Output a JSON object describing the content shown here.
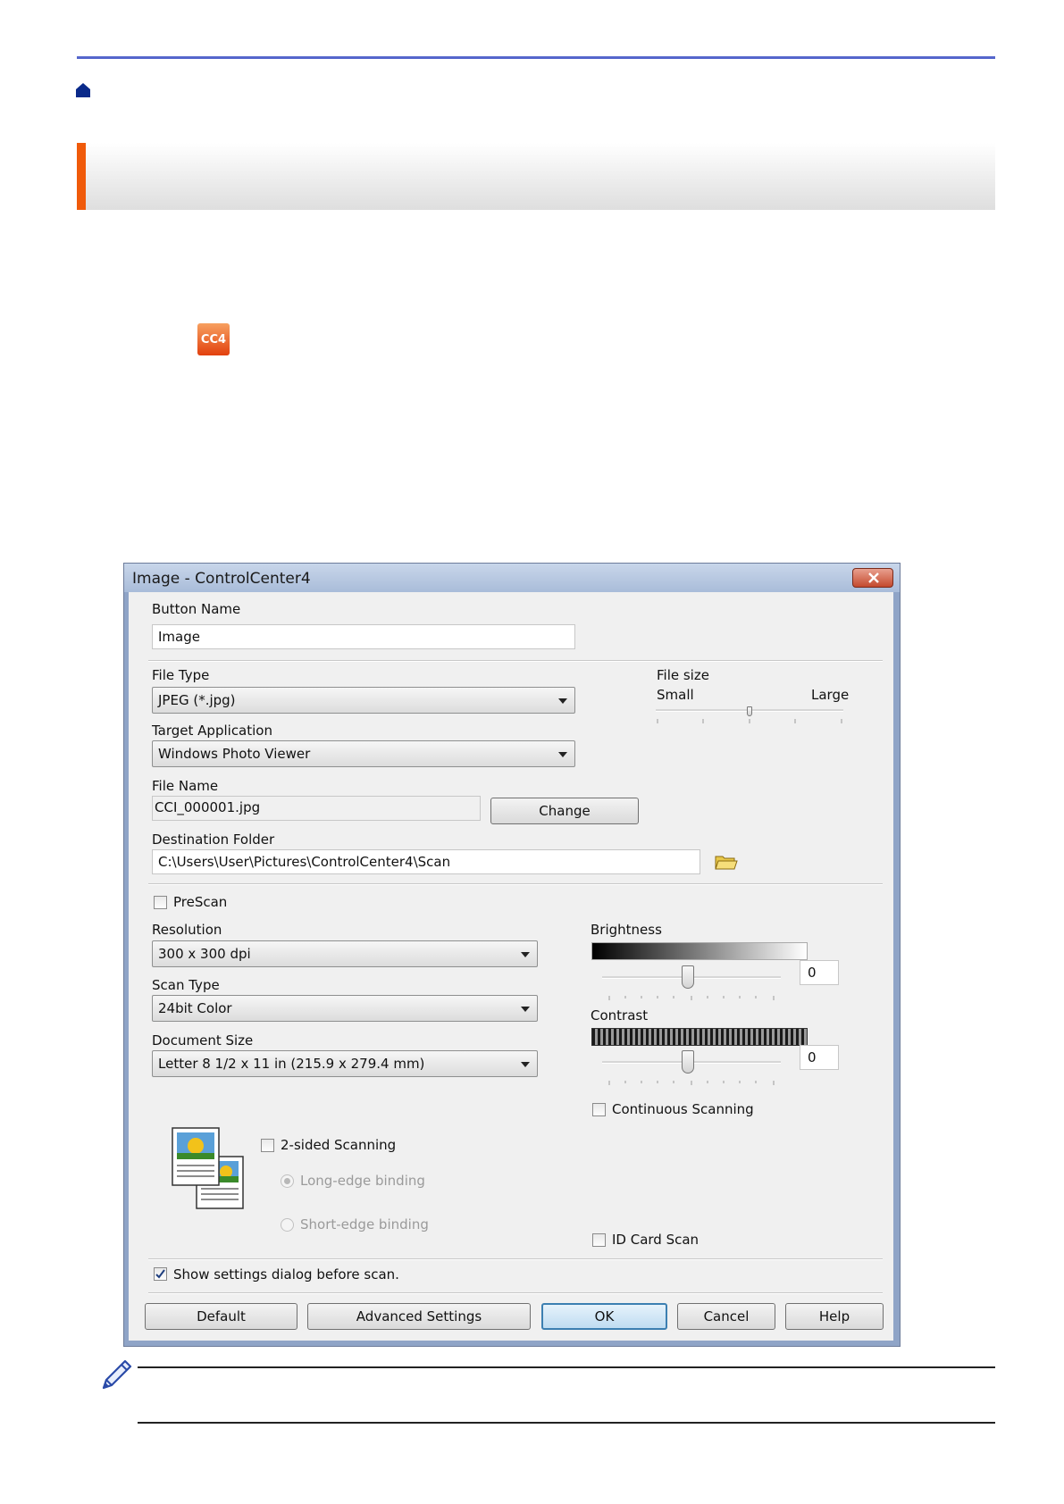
{
  "dialog": {
    "title": "Image - ControlCenter4",
    "button_name_label": "Button Name",
    "button_name_value": "Image",
    "file_type_label": "File Type",
    "file_type_value": "JPEG (*.jpg)",
    "file_size_label": "File size",
    "file_size_small": "Small",
    "file_size_large": "Large",
    "file_size_level": 0.5,
    "target_app_label": "Target Application",
    "target_app_value": "Windows Photo Viewer",
    "file_name_label": "File Name",
    "file_name_value": "CCI_000001.jpg",
    "change_button": "Change",
    "destination_label": "Destination Folder",
    "destination_value": "C:\\Users\\User\\Pictures\\ControlCenter4\\Scan",
    "prescan_label": "PreScan",
    "resolution_label": "Resolution",
    "resolution_value": "300 x 300 dpi",
    "scan_type_label": "Scan Type",
    "scan_type_value": "24bit Color",
    "document_size_label": "Document Size",
    "document_size_value": "Letter 8 1/2 x 11 in (215.9 x 279.4 mm)",
    "brightness_label": "Brightness",
    "brightness_value": "0",
    "contrast_label": "Contrast",
    "contrast_value": "0",
    "continuous_label": "Continuous Scanning",
    "two_sided_label": "2-sided Scanning",
    "long_edge_label": "Long-edge binding",
    "short_edge_label": "Short-edge binding",
    "id_card_label": "ID Card Scan",
    "show_settings_label": "Show settings dialog before scan.",
    "buttons": {
      "default": "Default",
      "advanced": "Advanced Settings",
      "ok": "OK",
      "cancel": "Cancel",
      "help": "Help"
    }
  },
  "icons": {
    "home": "home-icon",
    "app": "controlcenter4-icon",
    "folder": "folder-icon",
    "note": "pencil-icon",
    "duplex": "duplex-pages-icon",
    "cc4_text": "CC4"
  },
  "colors": {
    "rule": "#5566cc",
    "accent": "#f05a0a"
  }
}
